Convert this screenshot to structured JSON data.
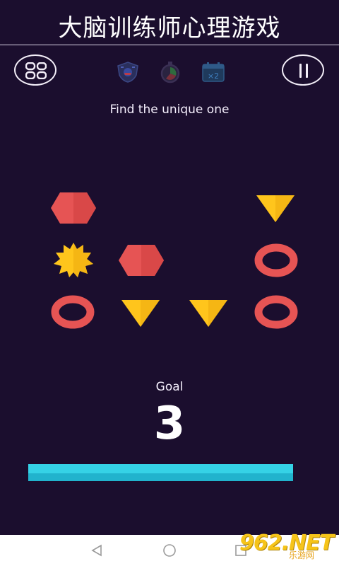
{
  "banner": {
    "title": "大脑训练师心理游戏"
  },
  "top_bar": {
    "menu_icon": "grid-icon",
    "status_icons": [
      "shield-badge-icon",
      "stopwatch-icon",
      "calendar-x2-icon"
    ],
    "pause_icon": "pause-icon"
  },
  "prompt": "Find the unique one",
  "board": {
    "tiles": [
      {
        "row": 1,
        "col": 1,
        "shape": "hexagon",
        "color": "#e65454"
      },
      {
        "row": 1,
        "col": 4,
        "shape": "triangle-down",
        "color": "#ffc51c"
      },
      {
        "row": 2,
        "col": 1,
        "shape": "starburst",
        "color": "#ffc51c"
      },
      {
        "row": 2,
        "col": 2,
        "shape": "hexagon",
        "color": "#e65454"
      },
      {
        "row": 2,
        "col": 4,
        "shape": "ring",
        "color": "#e65454"
      },
      {
        "row": 3,
        "col": 1,
        "shape": "ring",
        "color": "#e65454"
      },
      {
        "row": 3,
        "col": 2,
        "shape": "triangle-down",
        "color": "#ffc51c"
      },
      {
        "row": 3,
        "col": 3,
        "shape": "triangle-down",
        "color": "#ffc51c"
      },
      {
        "row": 3,
        "col": 4,
        "shape": "ring",
        "color": "#e65454"
      }
    ]
  },
  "goal": {
    "label": "Goal",
    "value": "3"
  },
  "progress": {
    "fraction": 1.0,
    "color": "#35d2e6"
  },
  "nav": {
    "icons": [
      "back-triangle-icon",
      "home-circle-icon",
      "recents-square-icon"
    ]
  },
  "watermark": {
    "logo": "962.NET",
    "sub": "乐游网"
  },
  "colors": {
    "background": "#1b0e2e",
    "red": "#e65454",
    "yellow": "#ffc51c",
    "cyan": "#35d2e6"
  }
}
